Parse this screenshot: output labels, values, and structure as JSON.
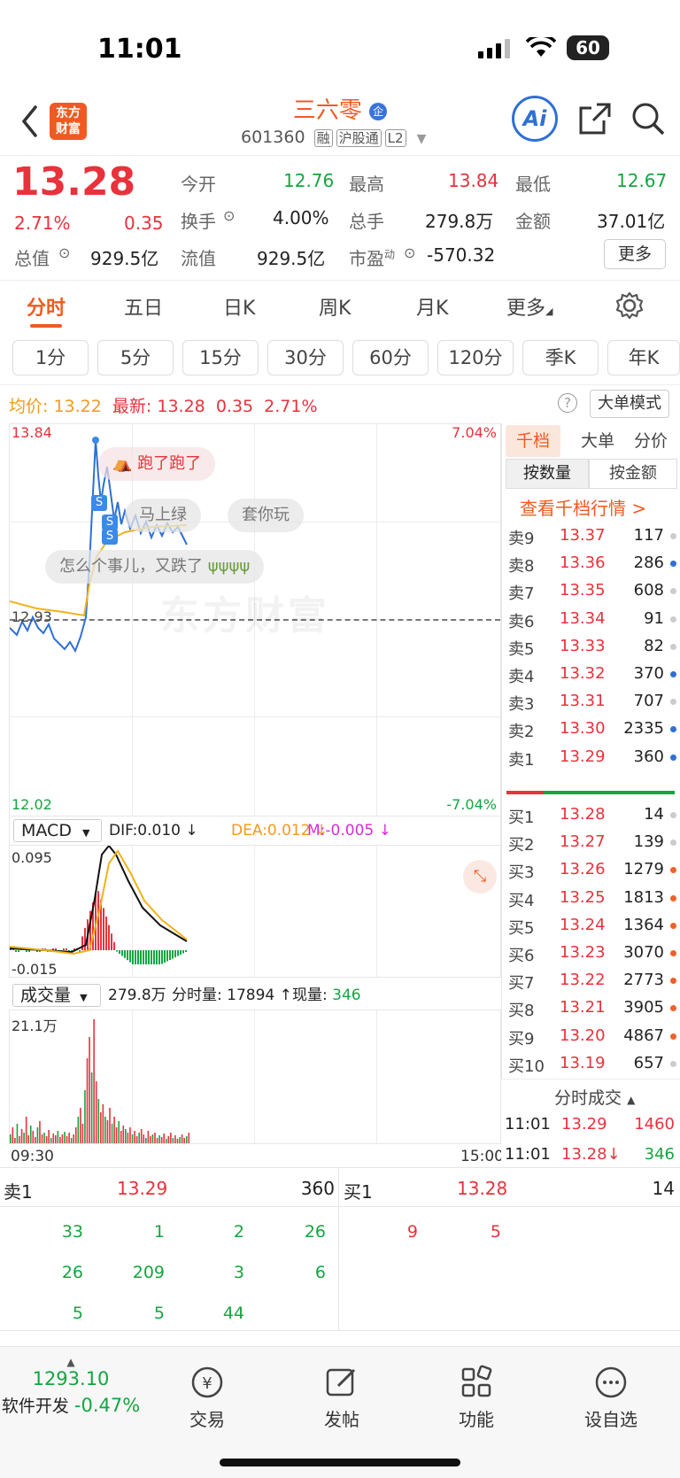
{
  "status_bar": {
    "time": "11:01",
    "battery": "60"
  },
  "header": {
    "back_icon": "chevron-left-icon",
    "logo_line1": "东方",
    "logo_line2": "财富",
    "stock_name": "三六零",
    "badge": "企",
    "stock_code": "601360",
    "tags": [
      "融",
      "沪股通",
      "L2"
    ],
    "ai_label": "Ai"
  },
  "quote": {
    "price": "13.28",
    "change_pct": "2.71%",
    "change_amt": "0.35",
    "open_label": "今开",
    "open": "12.76",
    "high_label": "最高",
    "high": "13.84",
    "low_label": "最低",
    "low": "12.67",
    "turnover_label": "换手",
    "turnover": "4.00%",
    "volume_label": "总手",
    "volume": "279.8万",
    "amount_label": "金额",
    "amount": "37.01亿",
    "mktcap_label": "总值",
    "mktcap": "929.5亿",
    "float_label": "流值",
    "float": "929.5亿",
    "pe_label": "市盈",
    "pe_sup": "动",
    "pe": "-570.32",
    "more_label": "更多"
  },
  "tabs": [
    "分时",
    "五日",
    "日K",
    "周K",
    "月K",
    "更多"
  ],
  "active_tab": "分时",
  "period_chips": [
    "1分",
    "5分",
    "15分",
    "30分",
    "60分",
    "120分",
    "季K",
    "年K"
  ],
  "info_line": {
    "avg_label": "均价:",
    "avg": "13.22",
    "latest_label": "最新:",
    "latest": "13.28",
    "chg": "0.35",
    "pct": "2.71%",
    "big_mode": "大单模式"
  },
  "price_chart": {
    "y_top": "13.84",
    "y_mid": "12.93",
    "y_bottom": "12.02",
    "pct_top": "7.04%",
    "pct_bottom": "-7.04%",
    "watermark": "东方财富",
    "comments": [
      "跑了跑了",
      "马上绿",
      "套你玩",
      "怎么个事儿，又跌了"
    ]
  },
  "macd": {
    "label": "MACD",
    "dif": "DIF:0.010 ↓",
    "dea": "DEA:0.012 ↓",
    "m": "M:-0.005 ↓",
    "y_top": "0.095",
    "y_bottom": "-0.015"
  },
  "volume_panel": {
    "label": "成交量",
    "total": "279.8万",
    "tick_label": "分时量:",
    "tick": "17894 ↑",
    "now_label": "现量:",
    "now": "346",
    "y_top": "21.1万",
    "x_start": "09:30",
    "x_end": "15:00"
  },
  "order_book": {
    "tabs": [
      "千档",
      "大单",
      "分价"
    ],
    "sub_tabs": [
      "按数量",
      "按金额"
    ],
    "link": "查看千档行情 >",
    "asks": [
      {
        "label": "卖9",
        "price": "13.37",
        "qty": "117",
        "dot": "#cccccc"
      },
      {
        "label": "卖8",
        "price": "13.36",
        "qty": "286",
        "dot": "#2f6fd6"
      },
      {
        "label": "卖7",
        "price": "13.35",
        "qty": "608",
        "dot": "#cccccc"
      },
      {
        "label": "卖6",
        "price": "13.34",
        "qty": "91",
        "dot": "#cccccc"
      },
      {
        "label": "卖5",
        "price": "13.33",
        "qty": "82",
        "dot": "#cccccc"
      },
      {
        "label": "卖4",
        "price": "13.32",
        "qty": "370",
        "dot": "#2f6fd6"
      },
      {
        "label": "卖3",
        "price": "13.31",
        "qty": "707",
        "dot": "#cccccc"
      },
      {
        "label": "卖2",
        "price": "13.30",
        "qty": "2335",
        "dot": "#2f6fd6"
      },
      {
        "label": "卖1",
        "price": "13.29",
        "qty": "360",
        "dot": "#2f6fd6"
      }
    ],
    "bids": [
      {
        "label": "买1",
        "price": "13.28",
        "qty": "14",
        "dot": "#cccccc"
      },
      {
        "label": "买2",
        "price": "13.27",
        "qty": "139",
        "dot": "#cccccc"
      },
      {
        "label": "买3",
        "price": "13.26",
        "qty": "1279",
        "dot": "#f0612a"
      },
      {
        "label": "买4",
        "price": "13.25",
        "qty": "1813",
        "dot": "#f0612a"
      },
      {
        "label": "买5",
        "price": "13.24",
        "qty": "1364",
        "dot": "#f0612a"
      },
      {
        "label": "买6",
        "price": "13.23",
        "qty": "3070",
        "dot": "#f0612a"
      },
      {
        "label": "买7",
        "price": "13.22",
        "qty": "2773",
        "dot": "#f0612a"
      },
      {
        "label": "买8",
        "price": "13.21",
        "qty": "3905",
        "dot": "#f0612a"
      },
      {
        "label": "买9",
        "price": "13.20",
        "qty": "4867",
        "dot": "#f0612a"
      },
      {
        "label": "买10",
        "price": "13.19",
        "qty": "657",
        "dot": "#cccccc"
      }
    ],
    "trades_header": "分时成交",
    "trades": [
      {
        "time": "11:01",
        "price": "13.29",
        "qty": "1460"
      },
      {
        "time": "11:01",
        "price": "13.28↓",
        "qty": "346"
      }
    ]
  },
  "level_table": {
    "sell_label": "卖1",
    "sell_price": "13.29",
    "sell_qty": "360",
    "buy_label": "买1",
    "buy_price": "13.28",
    "buy_qty": "14",
    "sell_queue": [
      [
        "33",
        "1",
        "2",
        "26"
      ],
      [
        "26",
        "209",
        "3",
        "6"
      ],
      [
        "5",
        "5",
        "44",
        ""
      ]
    ],
    "buy_queue": [
      [
        "9",
        "5"
      ]
    ]
  },
  "bottom_nav": {
    "index_value": "1293.10",
    "index_name": "软件开发",
    "index_change": "-0.47%",
    "items": [
      "交易",
      "发帖",
      "功能",
      "设自选"
    ]
  }
}
